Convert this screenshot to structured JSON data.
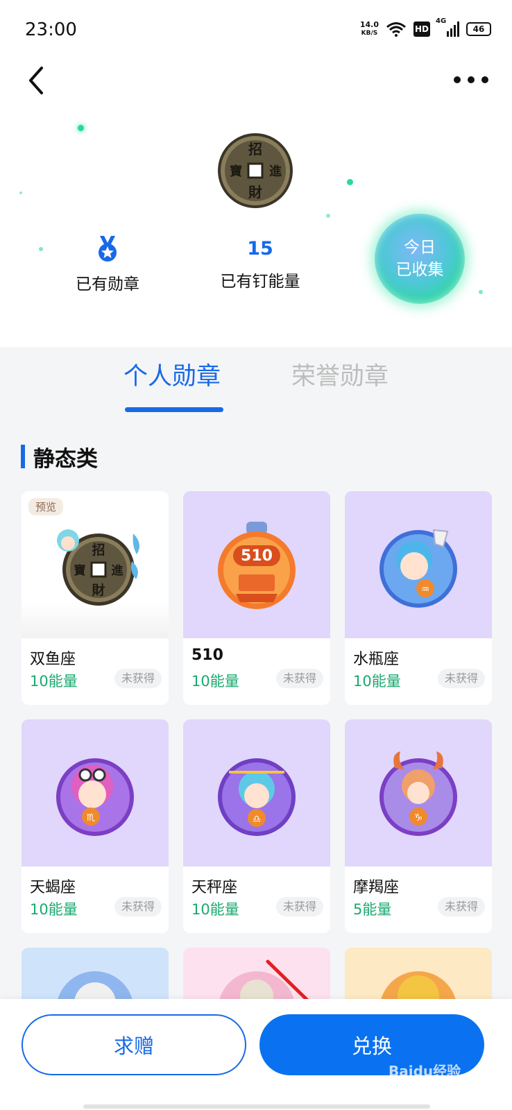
{
  "status_bar": {
    "time": "23:00",
    "net_speed": "14.0",
    "net_unit": "KB/S",
    "hd": "HD",
    "network": "4G",
    "battery": "46"
  },
  "header": {
    "back_icon": "chevron-left-icon",
    "more_icon": "more-dots-icon"
  },
  "summary": {
    "badge_icon": "medal-icon",
    "badge_label": "已有勋章",
    "energy_value": "15",
    "energy_label": "已有钉能量",
    "collect_line1": "今日",
    "collect_line2": "已收集"
  },
  "tabs": [
    {
      "label": "个人勋章",
      "active": true
    },
    {
      "label": "荣誉勋章",
      "active": false
    }
  ],
  "section": {
    "title": "静态类"
  },
  "badges": [
    {
      "name": "双鱼座",
      "energy": "10能量",
      "status": "未获得",
      "preview": "预览",
      "bg": "#ffffff"
    },
    {
      "name": "510",
      "energy": "10能量",
      "status": "未获得",
      "bg": "#e1d6fb"
    },
    {
      "name": "水瓶座",
      "energy": "10能量",
      "status": "未获得",
      "bg": "#e1d6fb"
    },
    {
      "name": "天蝎座",
      "energy": "10能量",
      "status": "未获得",
      "bg": "#e1d6fb"
    },
    {
      "name": "天秤座",
      "energy": "10能量",
      "status": "未获得",
      "bg": "#e1d6fb"
    },
    {
      "name": "摩羯座",
      "energy": "5能量",
      "status": "未获得",
      "bg": "#e1d6fb"
    }
  ],
  "partial_row_colors": [
    "#cfe3fb",
    "#fde1ef",
    "#fde9c4"
  ],
  "actions": {
    "ask_label": "求赠",
    "exchange_label": "兑换",
    "watermark": "Baidu经验"
  },
  "colors": {
    "accent": "#1769e8",
    "energy_green": "#1aa970",
    "card_purple": "#e1d6fb"
  }
}
